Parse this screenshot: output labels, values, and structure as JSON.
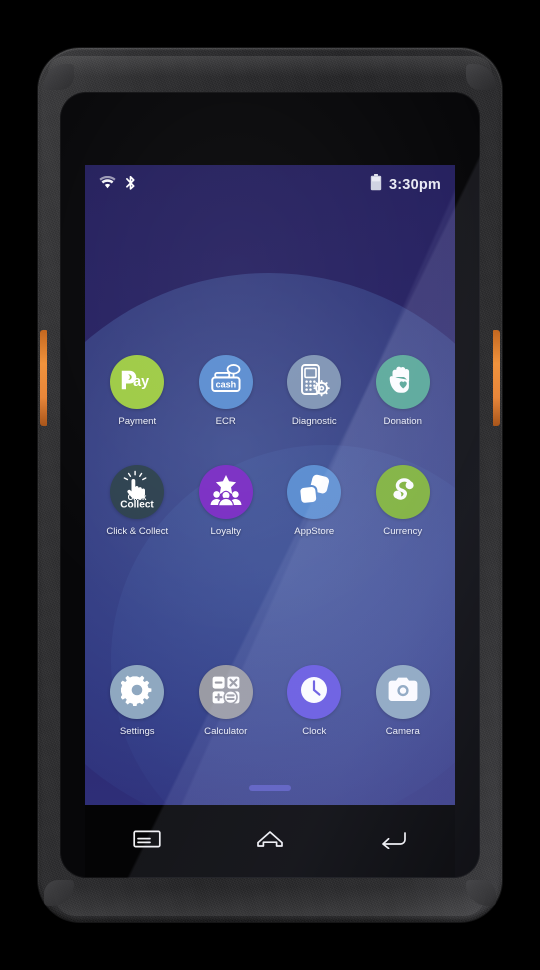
{
  "device": {
    "type": "rugged-handheld-payment-terminal",
    "frame_color": "#2c2c2e",
    "accent_color": "#e8863a"
  },
  "screen": {
    "wallpaper_base": "#262466",
    "wallpaper_dome": "#4a6cb4"
  },
  "status_bar": {
    "wifi_icon": "wifi-icon",
    "bluetooth_icon": "bluetooth-icon",
    "battery_icon": "battery-icon",
    "time": "3:30pm"
  },
  "app_grid": {
    "rows": [
      {
        "apps": [
          {
            "label": "Payment",
            "icon": "pay-logo-icon",
            "bg": "#9ecb45",
            "fg": "#ffffff"
          },
          {
            "label": "ECR",
            "icon": "cash-register-icon",
            "bg": "#5b8dd0",
            "fg": "#ffffff"
          },
          {
            "label": "Diagnostic",
            "icon": "terminal-gear-icon",
            "bg": "#8095b5",
            "fg": "#ffffff"
          },
          {
            "label": "Donation",
            "icon": "hand-heart-icon",
            "bg": "#55a795",
            "fg": "#ffffff"
          }
        ]
      },
      {
        "apps": [
          {
            "label": "Click & Collect",
            "icon": "click-collect-icon",
            "bg": "#2e4250",
            "fg": "#ffffff"
          },
          {
            "label": "Loyalty",
            "icon": "star-people-icon",
            "bg": "#7b2fc4",
            "fg": "#ffffff"
          },
          {
            "label": "AppStore",
            "icon": "app-squares-icon",
            "bg": "#5b8dd0",
            "fg": "#ffffff"
          },
          {
            "label": "Currency",
            "icon": "currency-s-icon",
            "bg": "#7eb235",
            "fg": "#ffffff"
          }
        ]
      },
      {
        "apps": [
          {
            "label": "Settings",
            "icon": "gear-icon",
            "bg": "#8fa8c0",
            "fg": "#ffffff"
          },
          {
            "label": "Calculator",
            "icon": "calculator-icon",
            "bg": "#9a9ba4",
            "fg": "#ffffff"
          },
          {
            "label": "Clock",
            "icon": "clock-icon",
            "bg": "#6759e0",
            "fg": "#ffffff"
          },
          {
            "label": "Camera",
            "icon": "camera-icon",
            "bg": "#8fa8c0",
            "fg": "#ffffff"
          }
        ]
      }
    ]
  },
  "nav_bar": {
    "buttons": [
      {
        "name": "recents-menu-icon",
        "label": "Recents"
      },
      {
        "name": "home-icon",
        "label": "Home"
      },
      {
        "name": "back-icon",
        "label": "Back"
      }
    ]
  }
}
